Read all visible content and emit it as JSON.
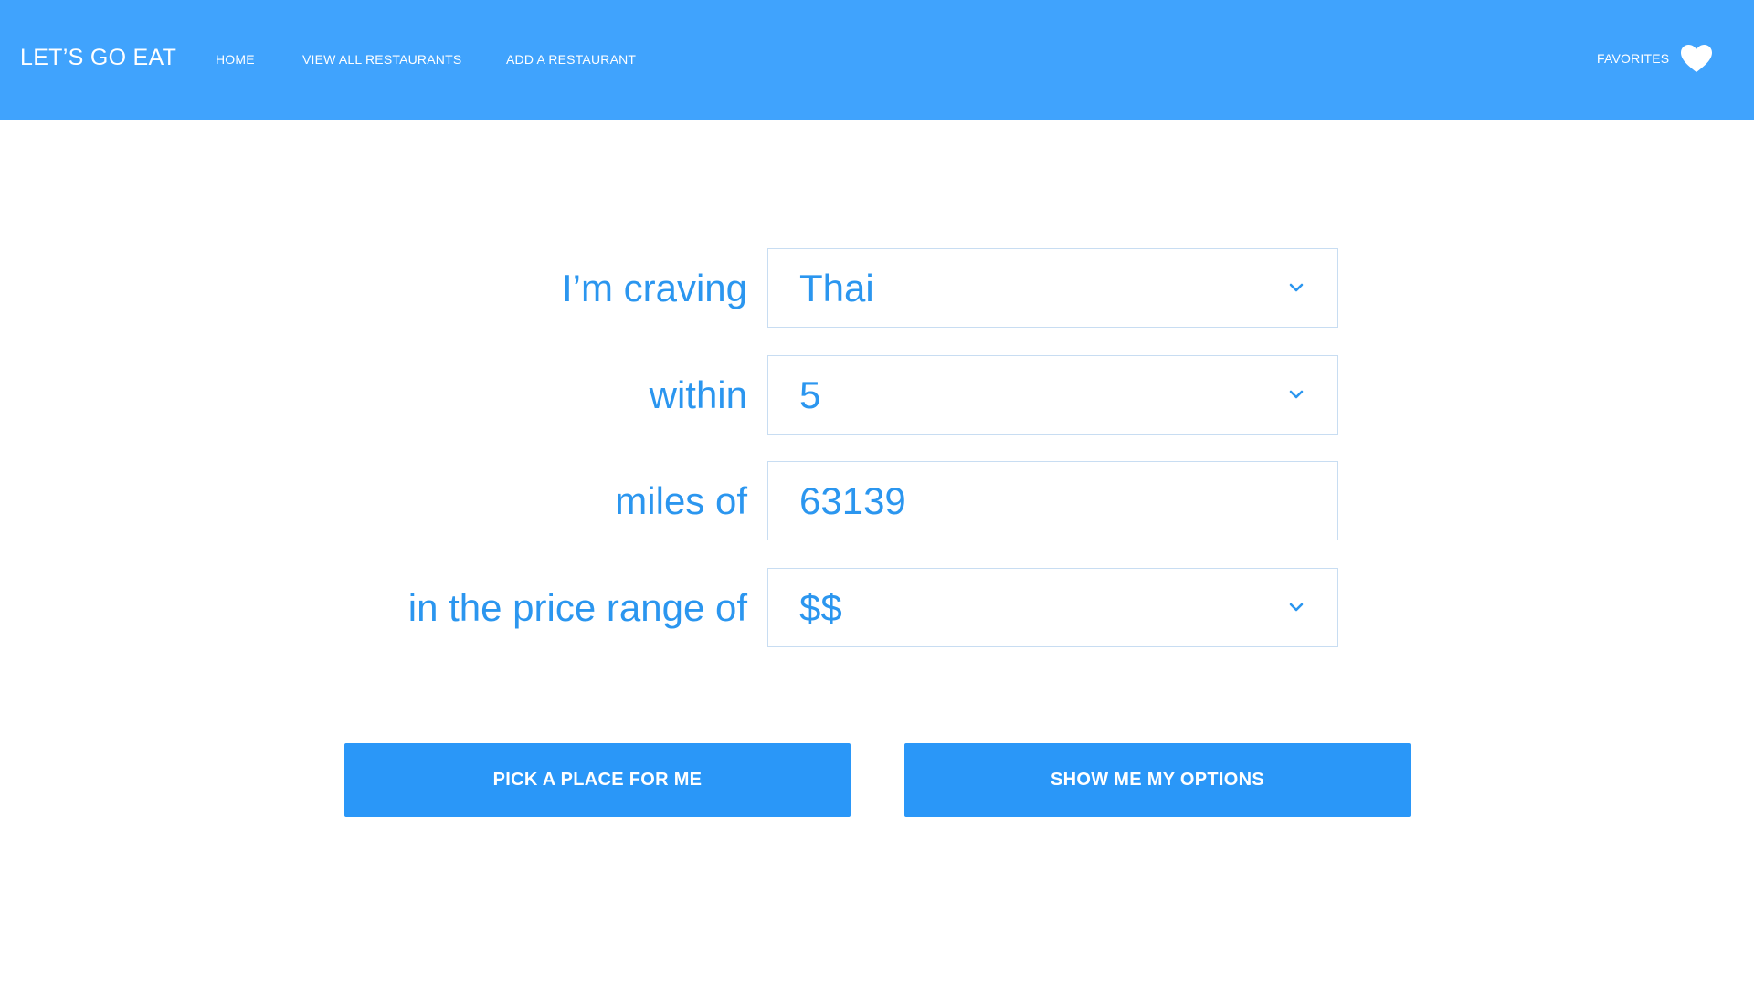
{
  "header": {
    "brand": "LET’S GO EAT",
    "nav": {
      "home": "HOME",
      "view_all": "VIEW ALL RESTAURANTS",
      "add": "ADD A RESTAURANT"
    },
    "favorites_label": "FAVORITES",
    "favorites_icon": "heart-icon"
  },
  "form": {
    "craving": {
      "label": "I’m craving",
      "value": "Thai"
    },
    "distance": {
      "label": "within",
      "value": "5"
    },
    "location": {
      "label": "miles of",
      "value": "63139"
    },
    "price": {
      "label": "in the price range of",
      "value": "$$"
    },
    "dropdown_icon": "chevron-down-icon"
  },
  "actions": {
    "pick": "PICK A PLACE FOR ME",
    "show": "SHOW ME MY OPTIONS"
  },
  "colors": {
    "header_bg": "#40a3fd",
    "accent": "#2a97f8",
    "text_accent": "#2b96ef",
    "field_border": "#c8ddf2"
  }
}
